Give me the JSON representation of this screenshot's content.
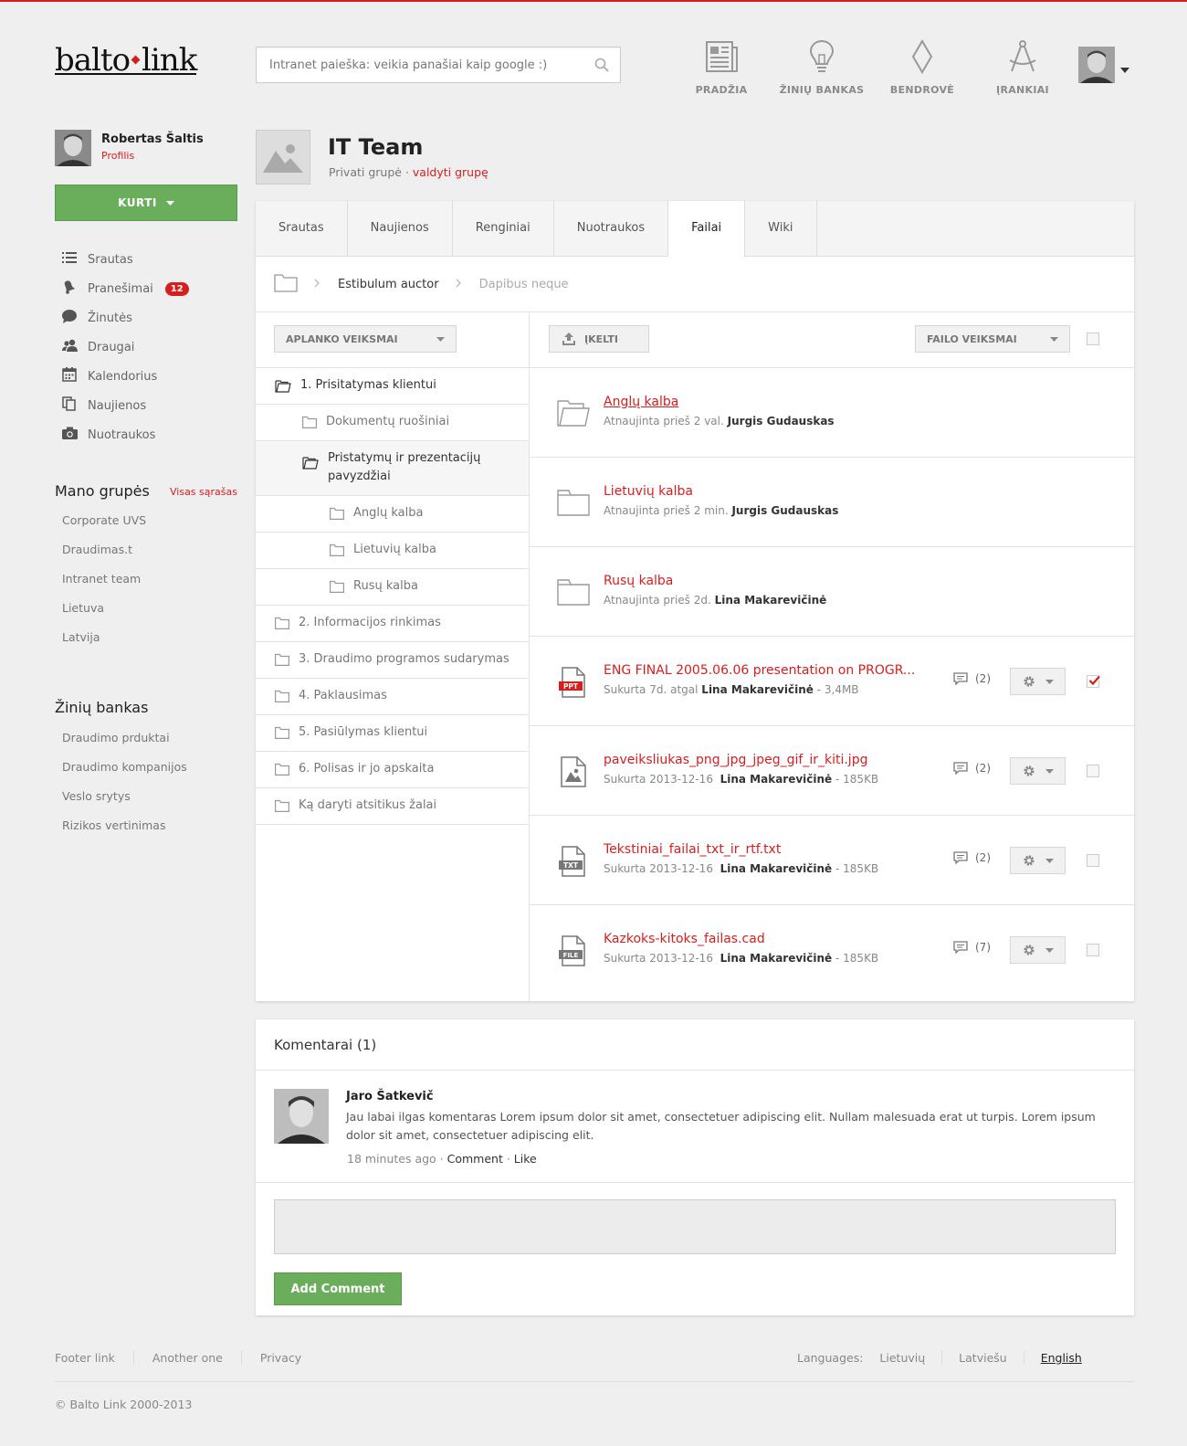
{
  "brand": {
    "logo_left": "balto",
    "logo_right": "link"
  },
  "search": {
    "placeholder": "Intranet paieška: veikia panašiai kaip google :)"
  },
  "topnav": [
    {
      "label": "PRADŽIA",
      "icon": "newspaper-icon"
    },
    {
      "label": "ŽINIŲ BANKAS",
      "icon": "lightbulb-icon"
    },
    {
      "label": "BENDROVĖ",
      "icon": "diamond-icon"
    },
    {
      "label": "ĮRANKIAI",
      "icon": "compass-icon"
    }
  ],
  "user": {
    "name": "Robertas Šaltis",
    "profile_link": "Profilis"
  },
  "create_button": "KURTI",
  "side_menu": [
    {
      "label": "Srautas",
      "icon": "list-icon"
    },
    {
      "label": "Pranešimai",
      "icon": "bell-icon",
      "badge": "12"
    },
    {
      "label": "Žinutės",
      "icon": "chat-icon"
    },
    {
      "label": "Draugai",
      "icon": "users-icon"
    },
    {
      "label": "Kalendorius",
      "icon": "calendar-icon"
    },
    {
      "label": "Naujienos",
      "icon": "documents-icon"
    },
    {
      "label": "Nuotraukos",
      "icon": "camera-icon"
    }
  ],
  "my_groups": {
    "title": "Mano grupės",
    "all_link": "Visas sąrašas",
    "items": [
      "Corporate UVS",
      "Draudimas.t",
      "Intranet team",
      "Lietuva",
      "Latvija"
    ]
  },
  "knowledge": {
    "title": "Žinių bankas",
    "items": [
      "Draudimo prduktai",
      "Draudimo kompanijos",
      "Veslo srytys",
      "Rizikos vertinimas"
    ]
  },
  "group": {
    "title": "IT Team",
    "type": "Privati grupė",
    "sep": " · ",
    "manage_link": "valdyti grupę"
  },
  "tabs": [
    "Srautas",
    "Naujienos",
    "Renginiai",
    "Nuotraukos",
    "Failai",
    "Wiki"
  ],
  "active_tab": "Failai",
  "breadcrumb": [
    "Estibulum auctor",
    "Dapibus neque"
  ],
  "folder_actions": "APLANKO VEIKSMAI",
  "upload": "ĮKELTI",
  "file_actions": "FAILO VEIKSMAI",
  "tree": [
    {
      "label": "1. Prisitatymas klientui",
      "level": 0,
      "open": true
    },
    {
      "label": "Dokumentų ruošiniai",
      "level": 1
    },
    {
      "label": "Pristatymų ir prezentacijų pavyzdžiai",
      "level": 1,
      "open": true,
      "active": true
    },
    {
      "label": "Anglų kalba",
      "level": 2
    },
    {
      "label": "Lietuvių kalba",
      "level": 2
    },
    {
      "label": "Rusų kalba",
      "level": 2
    },
    {
      "label": "2. Informacijos rinkimas",
      "level": 0
    },
    {
      "label": "3. Draudimo programos sudarymas",
      "level": 0
    },
    {
      "label": "4. Paklausimas",
      "level": 0
    },
    {
      "label": "5. Pasiūlymas klientui",
      "level": 0
    },
    {
      "label": "6. Polisas ir jo apskaita",
      "level": 0
    },
    {
      "label": "Ką daryti atsitikus žalai",
      "level": 0
    }
  ],
  "files": [
    {
      "name": "Anglų kalba",
      "type": "folder-open",
      "meta": "Atnaujinta prieš 2 val.",
      "author": "Jurgis Gudauskas",
      "underline": true
    },
    {
      "name": "Lietuvių kalba",
      "type": "folder",
      "meta": "Atnaujinta prieš 2 min.",
      "author": "Jurgis Gudauskas"
    },
    {
      "name": "Rusų kalba",
      "type": "folder",
      "meta": "Atnaujinta prieš 2d.",
      "author": "Lina Makarevičinė"
    },
    {
      "name": "ENG FINAL 2005.06.06 presentation on PROGR...",
      "type": "ppt",
      "badge": "PPT",
      "meta": "Sukurta 7d. atgal",
      "author": "Lina Makarevičinė",
      "size": " - 3,4MB",
      "comments": "(2)",
      "checked": true
    },
    {
      "name": "paveiksliukas_png_jpg_jpeg_gif_ir_kiti.jpg",
      "type": "image",
      "meta": "Sukurta 2013-12-16",
      "author": "Lina Makarevičinė",
      "size": " - 185KB",
      "comments": "(2)"
    },
    {
      "name": "Tekstiniai_failai_txt_ir_rtf.txt",
      "type": "txt",
      "badge": "TXT",
      "meta": "Sukurta 2013-12-16",
      "author": "Lina Makarevičinė",
      "size": " - 185KB",
      "comments": "(2)"
    },
    {
      "name": "Kazkoks-kitoks_failas.cad",
      "type": "file",
      "badge": "FILE",
      "meta": "Sukurta 2013-12-16",
      "author": "Lina Makarevičinė",
      "size": " - 185KB",
      "comments": "(7)"
    }
  ],
  "comments": {
    "title": "Komentarai (1)",
    "items": [
      {
        "author": "Jaro Šatkevič",
        "text": "Jau labai ilgas komentaras Lorem ipsum dolor sit amet, consectetuer adipiscing elit. Nullam malesuada erat ut turpis. Lorem ipsum dolor sit amet, consectetuer adipiscing elit.",
        "time": "18 minutes ago",
        "comment_link": "Comment",
        "like_link": "Like"
      }
    ],
    "add_button": "Add Comment"
  },
  "footer": {
    "links": [
      "Footer link",
      "Another one",
      "Privacy"
    ],
    "languages_label": "Languages:",
    "languages": [
      "Lietuvių",
      "Latviešu",
      "English"
    ],
    "current_language": "English",
    "copyright": "© Balto Link 2000-2013"
  },
  "colors": {
    "accent": "#d71e1e",
    "green": "#6aae5c",
    "background": "#efefef"
  }
}
